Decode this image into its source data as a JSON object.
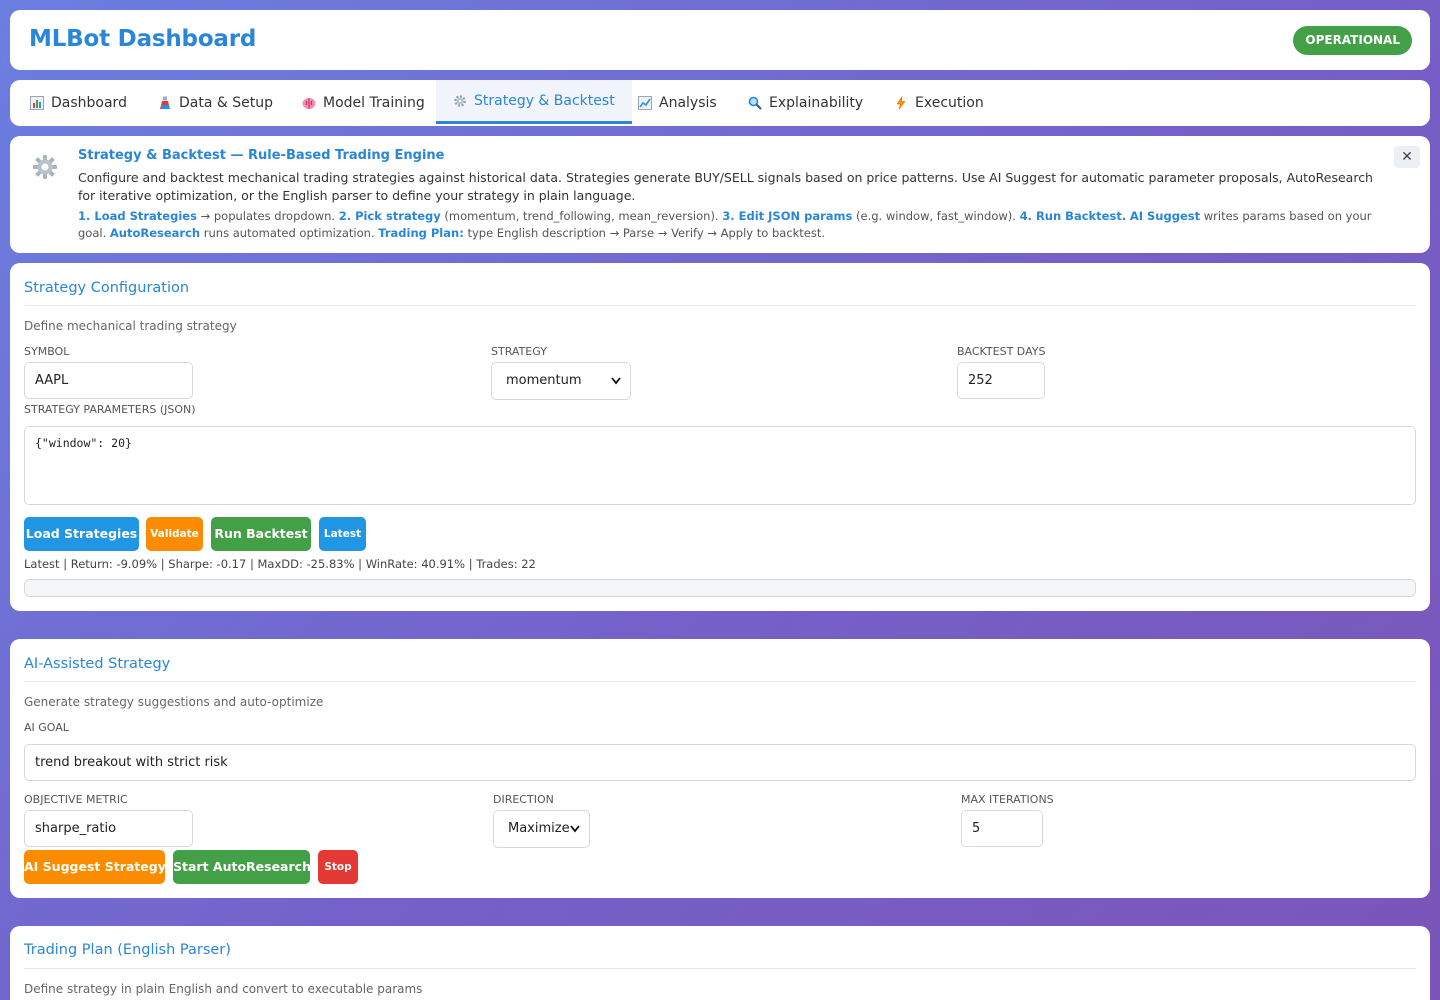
{
  "app": {
    "title": "MLBot Dashboard",
    "status": "OPERATIONAL"
  },
  "colors": {
    "accent": "#2a86d6",
    "success": "#43a047",
    "warning": "#fb8c00",
    "danger": "#e53935",
    "primary_button": "#2196e5"
  },
  "tabs": [
    {
      "label": "Dashboard",
      "icon": "bar-chart-icon",
      "active": false
    },
    {
      "label": "Data & Setup",
      "icon": "flask-icon",
      "active": false
    },
    {
      "label": "Model Training",
      "icon": "brain-icon",
      "active": false
    },
    {
      "label": "Strategy & Backtest",
      "icon": "gear-icon",
      "active": true
    },
    {
      "label": "Analysis",
      "icon": "line-chart-icon",
      "active": false
    },
    {
      "label": "Explainability",
      "icon": "magnifier-icon",
      "active": false
    },
    {
      "label": "Execution",
      "icon": "lightning-icon",
      "active": false
    }
  ],
  "info": {
    "title": "Strategy & Backtest — Rule-Based Trading Engine",
    "description": "Configure and backtest mechanical trading strategies against historical data. Strategies generate BUY/SELL signals based on price patterns. Use AI Suggest for automatic parameter proposals, AutoResearch for iterative optimization, or the English parser to define your strategy in plain language.",
    "steps": [
      {
        "bold": "1. Load Strategies",
        "text": " → populates dropdown. "
      },
      {
        "bold": "2. Pick strategy",
        "text": " (momentum, trend_following, mean_reversion). "
      },
      {
        "bold": "3. Edit JSON params",
        "text": " (e.g. window, fast_window). "
      },
      {
        "bold": "4. Run Backtest.",
        "text": " "
      },
      {
        "bold": "AI Suggest",
        "text": " writes params based on your goal. "
      },
      {
        "bold": "AutoResearch",
        "text": " runs automated optimization. "
      },
      {
        "bold": "Trading Plan:",
        "text": " type English description → Parse → Verify → Apply to backtest."
      }
    ],
    "close_label": "✕"
  },
  "config": {
    "title": "Strategy Configuration",
    "subtitle": "Define mechanical trading strategy",
    "symbol_label": "Symbol",
    "symbol_value": "AAPL",
    "strategy_label": "Strategy",
    "strategy_value": "momentum",
    "days_label": "Backtest Days",
    "days_value": "252",
    "params_label": "Strategy Parameters (JSON)",
    "params_value": "{\"window\": 20}",
    "buttons": {
      "load": "Load Strategies",
      "validate": "Validate",
      "run": "Run Backtest",
      "latest": "Latest"
    },
    "result": "Latest | Return: -9.09% | Sharpe: -0.17 | MaxDD: -25.83% | WinRate: 40.91% | Trades: 22",
    "progress": 0
  },
  "ai": {
    "title": "AI-Assisted Strategy",
    "subtitle": "Generate strategy suggestions and auto-optimize",
    "goal_label": "AI Goal",
    "goal_value": "trend breakout with strict risk",
    "metric_label": "Objective Metric",
    "metric_value": "sharpe_ratio",
    "direction_label": "Direction",
    "direction_value": "Maximize",
    "iterations_label": "Max Iterations",
    "iterations_value": "5",
    "buttons": {
      "suggest": "AI Suggest Strategy",
      "autoresearch": "Start AutoResearch",
      "stop": "Stop"
    }
  },
  "plan": {
    "title": "Trading Plan (English Parser)",
    "subtitle": "Define strategy in plain English and convert to executable params"
  }
}
